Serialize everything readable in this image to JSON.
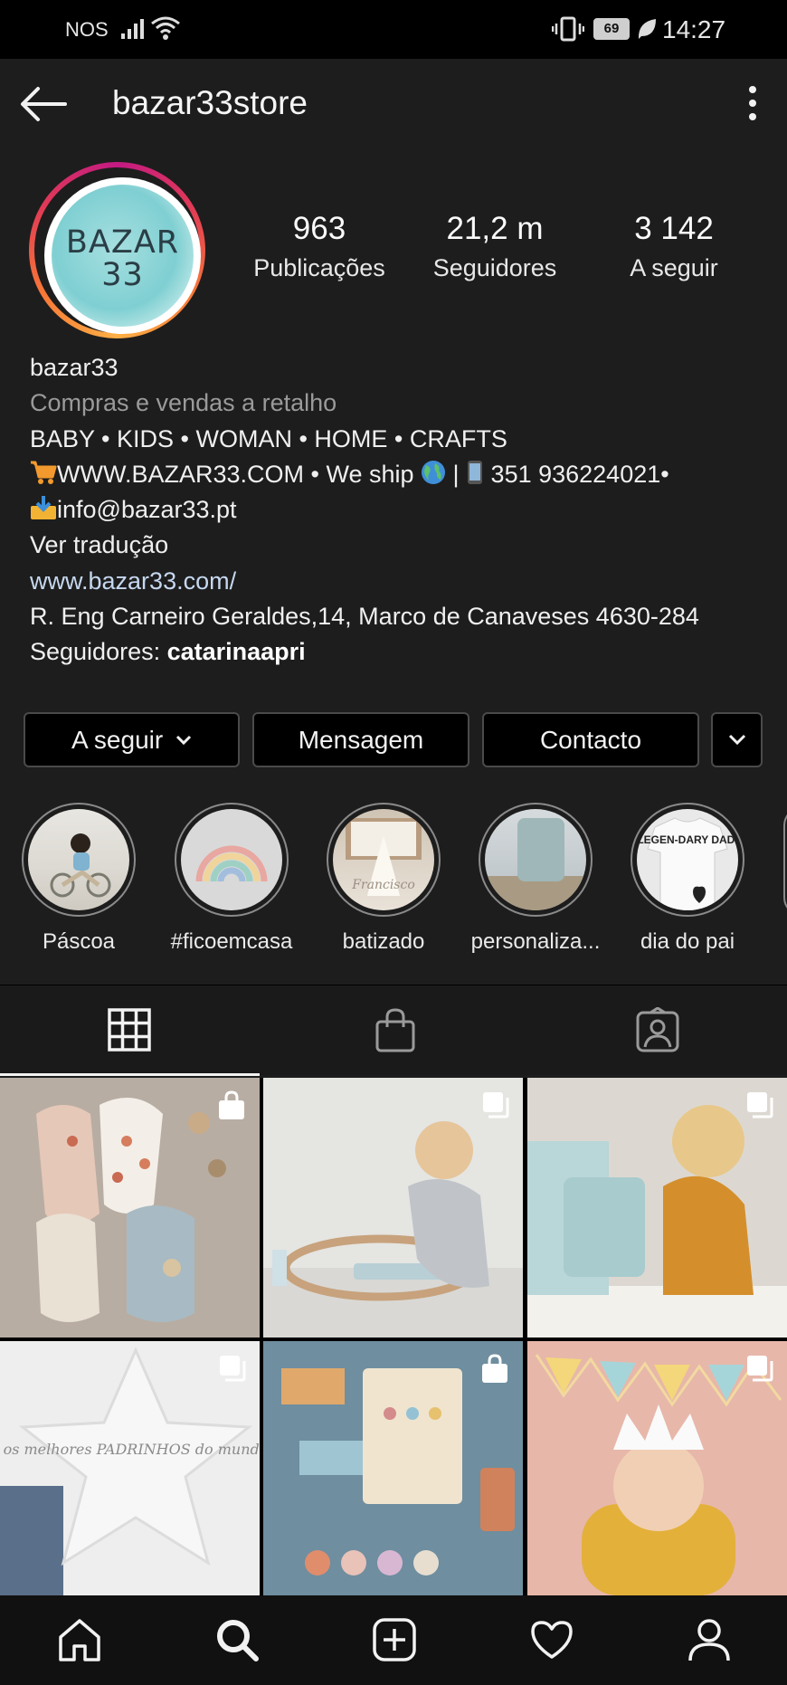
{
  "status_bar": {
    "carrier": "NOS",
    "battery": "69",
    "time": "14:27"
  },
  "header": {
    "username": "bazar33store"
  },
  "profile": {
    "avatar_text_line1": "BAZAR",
    "avatar_text_line2": "33",
    "stats": [
      {
        "value": "963",
        "label": "Publicações"
      },
      {
        "value": "21,2 m",
        "label": "Seguidores"
      },
      {
        "value": "3 142",
        "label": "A seguir"
      }
    ],
    "name": "bazar33",
    "category": "Compras e vendas a retalho",
    "bio_line1": "BABY • KIDS • WOMAN • HOME • CRAFTS",
    "bio_line2_a": "WWW.BAZAR33.COM • We ship ",
    "bio_line2_b": " | ",
    "bio_line2_c": " 351 936224021•",
    "bio_line3": "info@bazar33.pt",
    "translate": "Ver tradução",
    "website": "www.bazar33.com/",
    "address": "R. Eng Carneiro Geraldes,14, Marco de Canaveses 4630-284",
    "followers_prefix": "Seguidores: ",
    "followers_name": "catarinaapri"
  },
  "buttons": {
    "following": "A seguir",
    "message": "Mensagem",
    "contact": "Contacto"
  },
  "highlights": [
    {
      "label": "Páscoa"
    },
    {
      "label": "#ficoemcasa"
    },
    {
      "label": "batizado"
    },
    {
      "label": "personaliza..."
    },
    {
      "label": "dia do pai"
    }
  ],
  "highlight_overlay_text": {
    "batizado_script": "Francisco",
    "dia_do_pai_shirt": "LEGEN-DARY DAD."
  },
  "post_overlay_text": {
    "star_text": "os melhores PADRINHOS do mundo"
  },
  "colors": {
    "background": "#1d1d1d",
    "accent_ring": "#e13a56",
    "link": "#c6d8ef"
  },
  "icons": [
    "back-arrow-icon",
    "more-vertical-icon",
    "grid-icon",
    "shopping-bag-icon",
    "tagged-icon",
    "home-icon",
    "search-icon",
    "add-post-icon",
    "heart-icon",
    "profile-icon"
  ]
}
